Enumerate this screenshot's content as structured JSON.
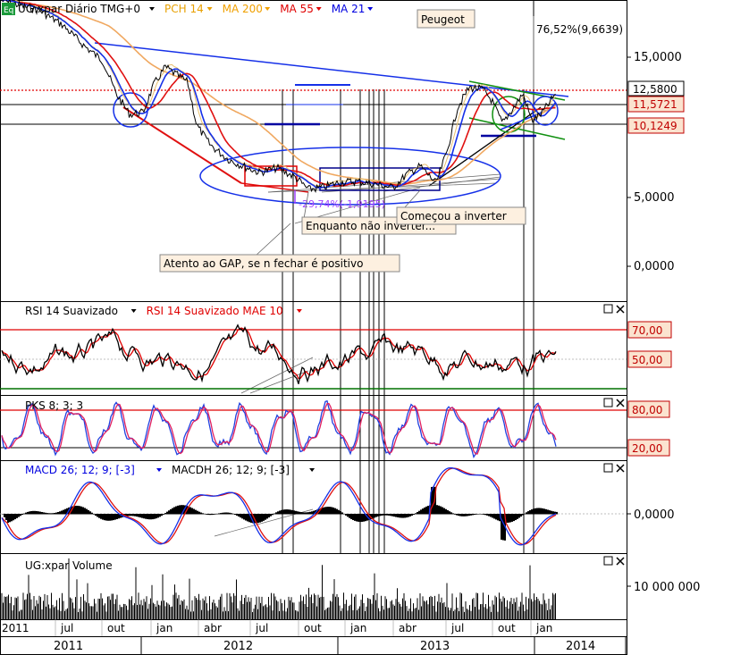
{
  "main_panel": {
    "badge": "Eq",
    "legend": [
      {
        "text": "UG:xpar Diário TMG+0",
        "color": "#000000"
      },
      {
        "text": "PCH 14",
        "color": "#e8a000"
      },
      {
        "text": "MA 200",
        "color": "#f0a000"
      },
      {
        "text": "MA 55",
        "color": "#e00000"
      },
      {
        "text": "MA 21",
        "color": "#0000e0"
      }
    ],
    "peugeot_label": "Peugeot",
    "percent_label": "76,52%(9,6639)",
    "price_labels": [
      "12,5800",
      "11,5721",
      "10,1249"
    ],
    "y_ticks": [
      "15,0000",
      "5,0000",
      "0,0000"
    ],
    "annotations": {
      "gap": "Atento ao GAP, se n fechar é positivo",
      "enquanto": "Enquanto não inverter...",
      "comecou": "Começou a inverter",
      "drop_measure": "-29,74%(-1,9195)"
    }
  },
  "rsi_panel": {
    "legend": [
      {
        "text": "RSI 14 Suavizado",
        "color": "#000000"
      },
      {
        "text": "RSI 14 Suavizado MAE 10",
        "color": "#e00000"
      }
    ],
    "levels": [
      "70,00",
      "50,00"
    ]
  },
  "pks_panel": {
    "legend": "PKS 8; 3; 3",
    "levels": [
      "80,00",
      "20,00"
    ]
  },
  "macd_panel": {
    "legend": [
      {
        "text": "MACD 26; 12; 9; [-3]",
        "color": "#0000e0"
      },
      {
        "text": "MACDH 26; 12; 9; [-3]",
        "color": "#000000"
      }
    ],
    "level": "0,0000"
  },
  "volume_panel": {
    "legend": "UG:xpar Volume",
    "level": "10 000 000"
  },
  "time_axis": {
    "months": [
      "2011",
      "jul",
      "out",
      "jan",
      "abr",
      "jul",
      "out",
      "jan",
      "abr",
      "jul",
      "out",
      "jan"
    ],
    "years": [
      "2011",
      "2012",
      "2013",
      "2014"
    ]
  },
  "colors": {
    "price": "#000000",
    "ma21": "#1530e8",
    "ma55": "#e01010",
    "ma200": "#f0a860",
    "pch": "#e8c070",
    "rsi_high": "#e00000",
    "rsi_low": "#007000",
    "stoch_k": "#2040e0",
    "stoch_d": "#e02060"
  }
}
